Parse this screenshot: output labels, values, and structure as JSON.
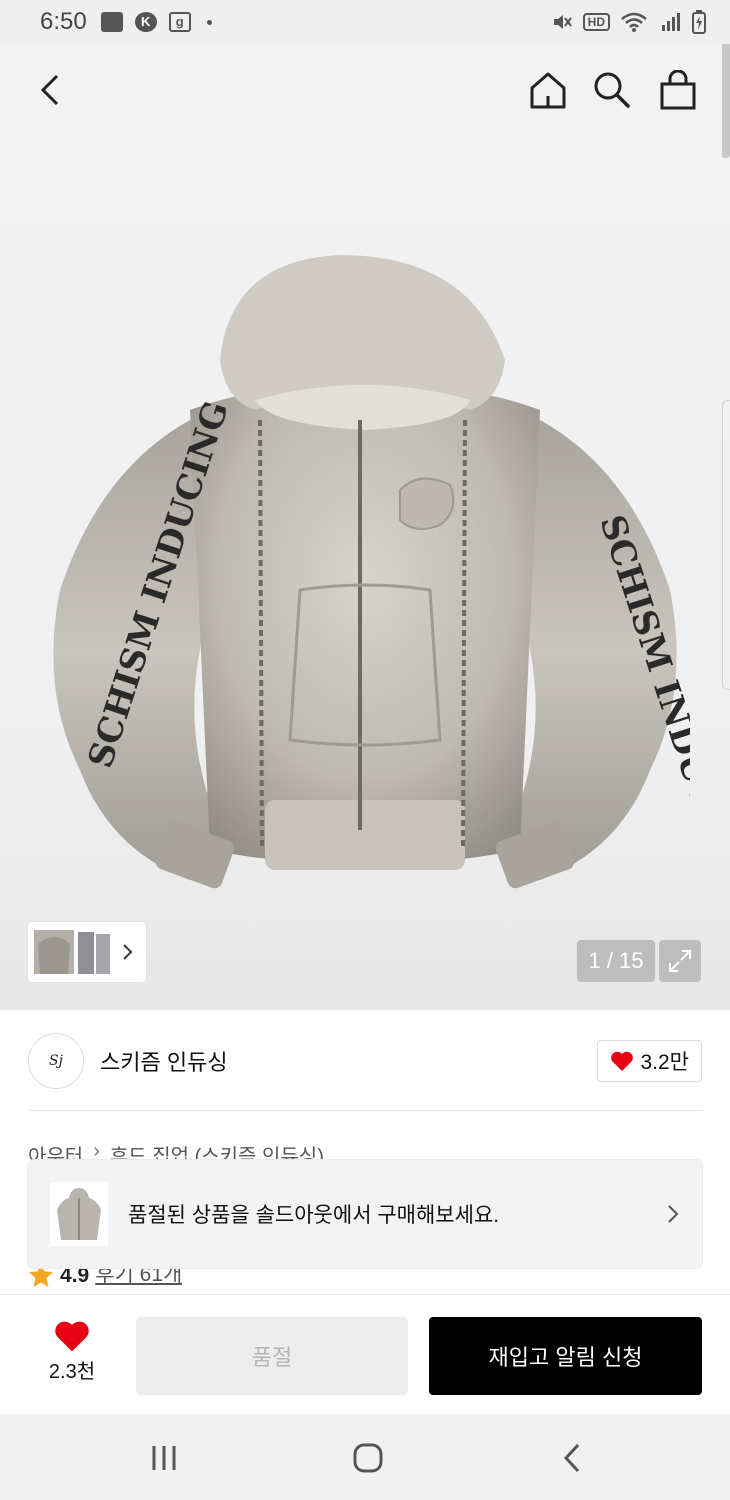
{
  "status_bar": {
    "time": "6:50",
    "notif_icons": [
      "gallery-icon",
      "k-app-icon",
      "g-app-icon"
    ],
    "k_letter": "K",
    "g_letter": "g",
    "hd": "HD",
    "wifi_label": "6"
  },
  "nav": {
    "icons": [
      "back-icon",
      "home-icon",
      "search-icon",
      "shopping-bag-icon"
    ]
  },
  "gallery": {
    "counter": "1 / 15"
  },
  "brand": {
    "logo_text": "Sj",
    "name": "스키즘 인듀싱",
    "likes": "3.2만",
    "like_color": "#e60012"
  },
  "breadcrumb": {
    "items": [
      "아우터",
      "후드 집업 (스키즘 인듀싱)"
    ]
  },
  "toast": {
    "message": "품절된 상품을 솔드아웃에서 구매해보세요."
  },
  "rating": {
    "score": "4.9",
    "reviews": "후기 61개",
    "star_color": "#f5a623"
  },
  "action_bar": {
    "wish_count": "2.3천",
    "soldout_label": "품절",
    "restock_label": "재입고 알림 신청"
  },
  "colors": {
    "accent_black": "#000000",
    "heart_red": "#e60012",
    "disabled_bg": "#ededed"
  }
}
